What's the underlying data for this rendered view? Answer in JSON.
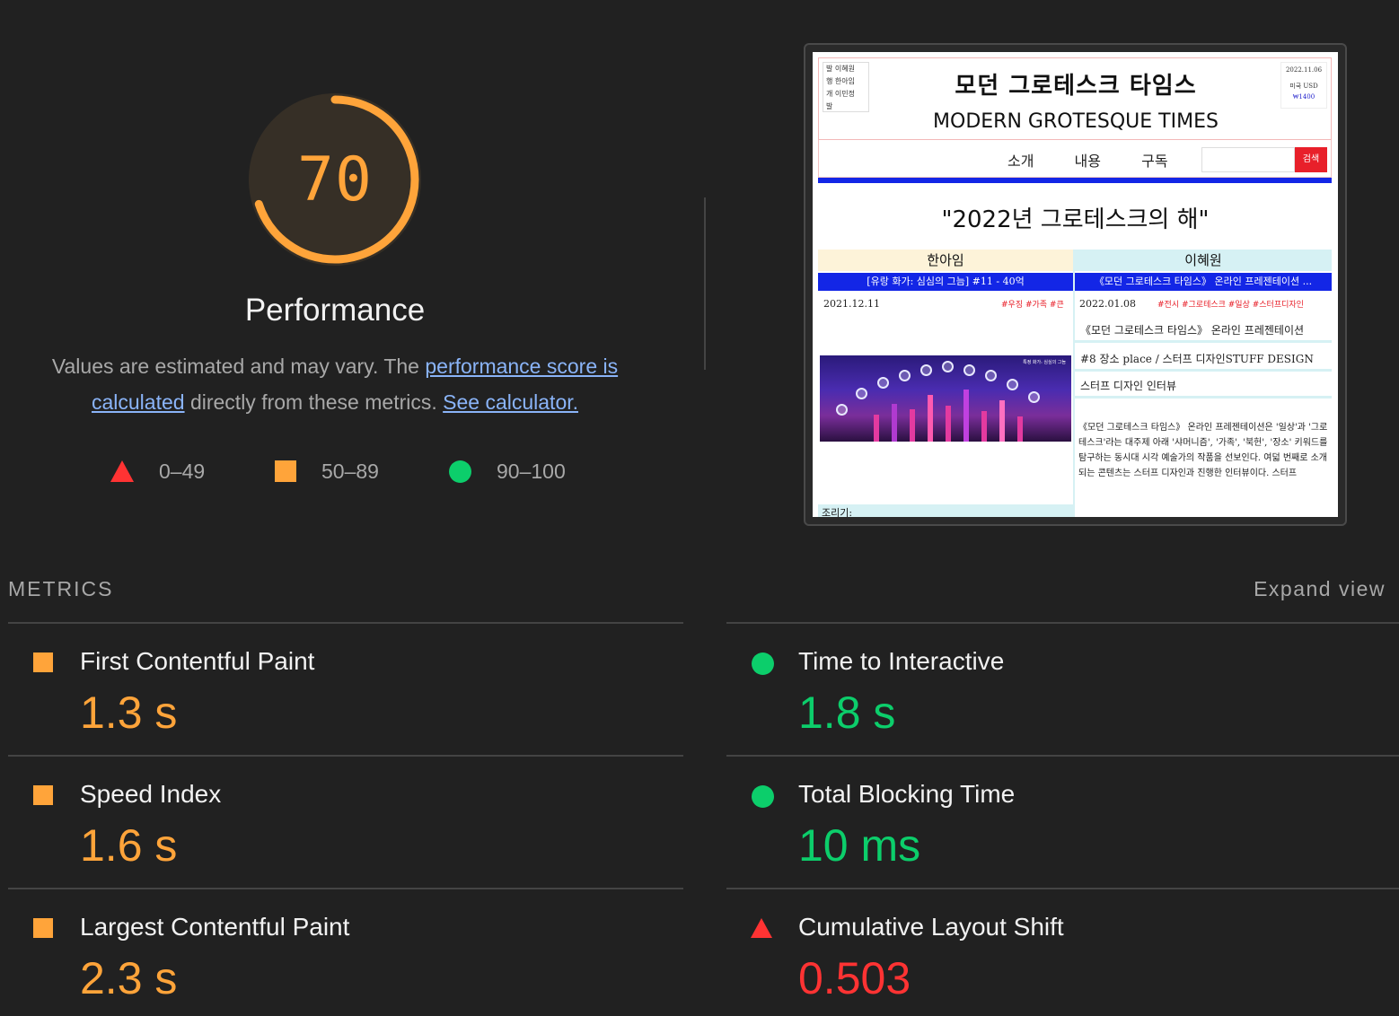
{
  "score": {
    "value": "70",
    "fraction": 0.7,
    "title": "Performance",
    "description_prefix": "Values are estimated and may vary. The ",
    "description_link1": "performance score is calculated",
    "description_middle": " directly from these metrics. ",
    "description_link2": "See calculator.",
    "color": "#ffa43a"
  },
  "legend": [
    {
      "label": "0–49",
      "shape": "triangle",
      "color": "#ff3333"
    },
    {
      "label": "50–89",
      "shape": "square",
      "color": "#ffa43a"
    },
    {
      "label": "90–100",
      "shape": "circle",
      "color": "#0cce6b"
    }
  ],
  "preview": {
    "staff": [
      "발",
      "행",
      "이혜원",
      "한아임",
      "개",
      "발",
      "이민정"
    ],
    "date": "2022.11.06",
    "currency_label": "미국 USD",
    "currency_value": "₩1400",
    "kor_title": "모던 그로테스크 타임스",
    "eng_title": "MODERN GROTESQUE TIMES",
    "nav": [
      "소개",
      "내용",
      "구독"
    ],
    "search_button": "검색",
    "headline": "\"2022년 그로테스크의 해\"",
    "col_left": "한아임",
    "col_right": "이혜원",
    "bar_left": "[유랑 화가: 심심의 그늠] #11 - 40억",
    "bar_right": "《모던 그로테스크 타임스》 온라인 프레젠테이션 ...",
    "date_left": "2021.12.11",
    "tags_left": "#우징 #가족 #큰",
    "date_right": "2022.01.08",
    "tags_right": "#전시 #그로테스크 #일상 #스터프디자인",
    "art_caption": "특정 화가: 심심의 그늠",
    "items_right": [
      "《모던 그로테스크 타임스》 온라인 프레젠테이션",
      "#8 장소 place / 스터프 디자인STUFF DESIGN",
      "스터프 디자인 인터뷰"
    ],
    "body_text": "《모던 그로테스크 타임스》 온라인 프레젠테이션은 '일상'과 '그로테스크'라는 대주제 아래 '샤머니즘', '가족', '북헌', '장소' 키워드를 탐구하는 동시대 시각 예술가의 작품을 선보인다. 여덟 번째로 소개되는 콘텐츠는 스터프 디자인과 진행한 인터뷰이다. 스터프",
    "left_foot": "조리기:"
  },
  "metrics_label": "METRICS",
  "expand_label": "Expand view",
  "metrics_left": [
    {
      "name": "First Contentful Paint",
      "value": "1.3 s",
      "rating": "average"
    },
    {
      "name": "Speed Index",
      "value": "1.6 s",
      "rating": "average"
    },
    {
      "name": "Largest Contentful Paint",
      "value": "2.3 s",
      "rating": "average"
    }
  ],
  "metrics_right": [
    {
      "name": "Time to Interactive",
      "value": "1.8 s",
      "rating": "pass"
    },
    {
      "name": "Total Blocking Time",
      "value": "10 ms",
      "rating": "pass"
    },
    {
      "name": "Cumulative Layout Shift",
      "value": "0.503",
      "rating": "fail"
    }
  ],
  "colors": {
    "pass": "#0cce6b",
    "average": "#ffa43a",
    "fail": "#ff3333",
    "link": "#8ab4f8",
    "background": "#212121"
  }
}
